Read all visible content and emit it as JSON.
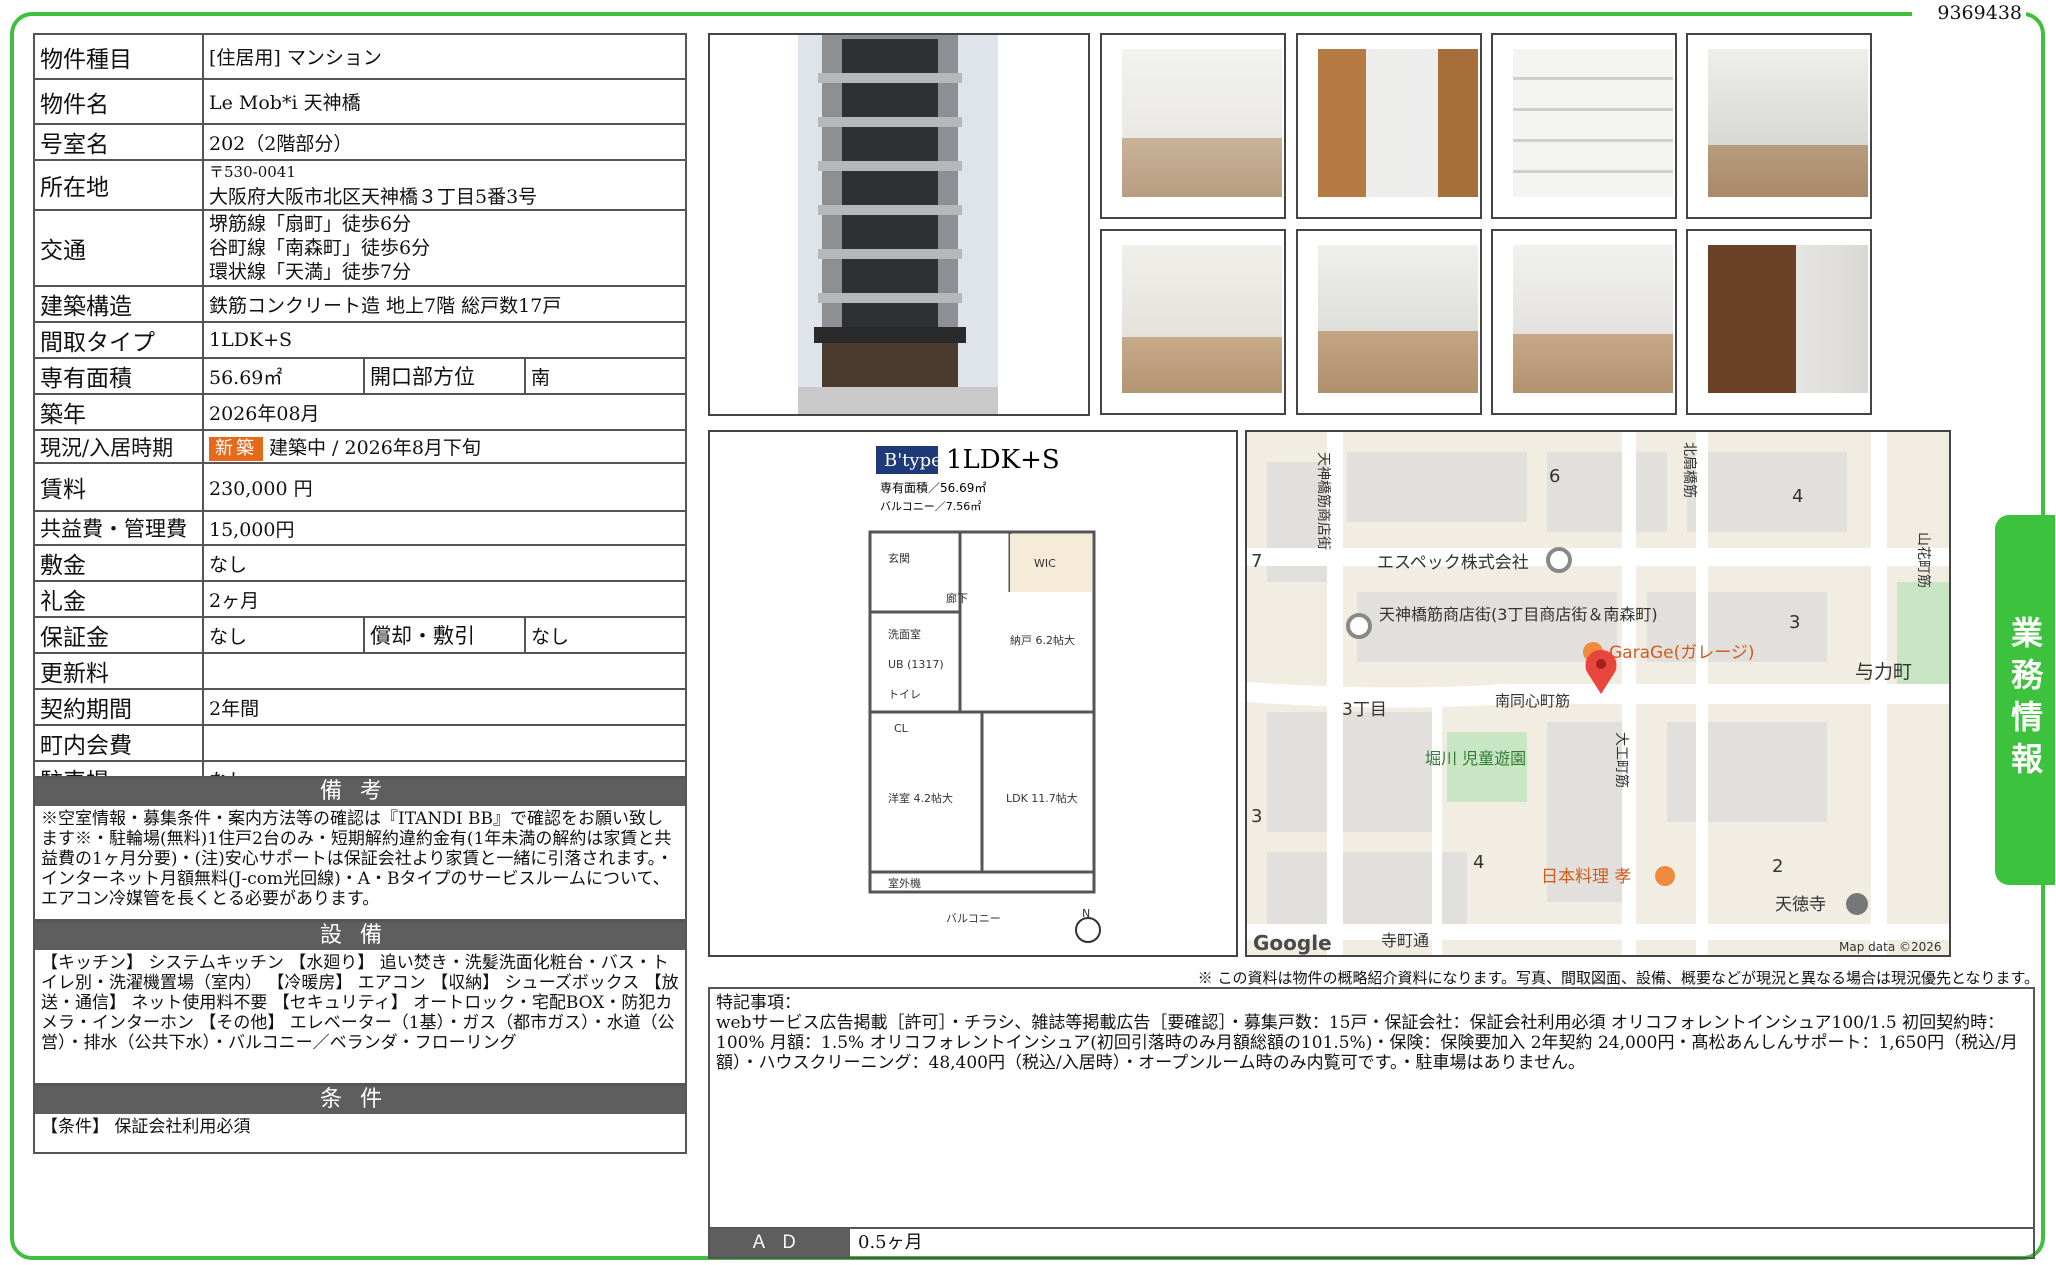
{
  "doc_number": "9369438",
  "side_tab": "業務情報",
  "property": {
    "type_label": "物件種目",
    "type_value": "[住居用] マンション",
    "name_label": "物件名",
    "name_value": "Le Mob*i 天神橋",
    "room_label": "号室名",
    "room_value": "202（2階部分）",
    "address_label": "所在地",
    "postal": "〒530-0041",
    "address": "大阪府大阪市北区天神橋３丁目5番3号",
    "transport_label": "交通",
    "transport": [
      "堺筋線「扇町」徒歩6分",
      "谷町線「南森町」徒歩6分",
      "環状線「天満」徒歩7分"
    ],
    "structure_label": "建築構造",
    "structure_value": "鉄筋コンクリート造 地上7階 総戸数17戸",
    "layout_label": "間取タイプ",
    "layout_value": "1LDK+S",
    "area_label": "専有面積",
    "area_value": "56.69㎡",
    "direction_label": "開口部方位",
    "direction_value": "南",
    "built_label": "築年",
    "built_value": "2026年08月",
    "status_label": "現況/入居時期",
    "status_badge": "新築",
    "status_value": "建築中 / 2026年8月下旬",
    "rent_label": "賃料",
    "rent_value": "230,000 円",
    "fee_label": "共益費・管理費",
    "fee_value": "15,000円",
    "deposit_label": "敷金",
    "deposit_value": "なし",
    "key_money_label": "礼金",
    "key_money_value": "2ヶ月",
    "guarantee_label": "保証金",
    "guarantee_value": "なし",
    "amort_label": "償却・敷引",
    "amort_value": "なし",
    "renewal_label": "更新料",
    "renewal_value": "",
    "contract_label": "契約期間",
    "contract_value": "2年間",
    "community_label": "町内会費",
    "community_value": "",
    "parking_label": "駐車場",
    "parking_value": "なし"
  },
  "notes": {
    "title": "備考",
    "text": "※空室情報・募集条件・案内方法等の確認は『ITANDI BB』で確認をお願い致します※・駐輪場(無料)1住戸2台のみ・短期解約違約金有(1年未満の解約は家賃と共益費の1ヶ月分要)・(注)安心サポートは保証会社より家賃と一緒に引落されます。・インターネット月額無料(J-com光回線)・A・Bタイプのサービスルームについて、エアコン冷媒管を長くとる必要があります。"
  },
  "equipment": {
    "title": "設備",
    "text": "【キッチン】 システムキッチン 【水廻り】 追い焚き・洗髪洗面化粧台・バス・トイレ別・洗濯機置場（室内） 【冷暖房】 エアコン 【収納】 シューズボックス 【放送・通信】 ネット使用料不要 【セキュリティ】 オートロック・宅配BOX・防犯カメラ・インターホン 【その他】 エレベーター（1基）・ガス（都市ガス）・水道（公営）・排水（公共下水）・バルコニー／ベランダ・フローリング"
  },
  "conditions": {
    "title": "条件",
    "text": "【条件】 保証会社利用必須"
  },
  "floorplan": {
    "type_mark": "B'type",
    "layout": "1LDK+S",
    "area": "専有面積／56.69㎡",
    "balcony": "バルコニー／7.56㎡",
    "rooms": [
      "WIC",
      "納戸 6.2帖大",
      "洋室 4.2帖大",
      "LDK 11.7帖大",
      "バルコニー",
      "UB (1317)",
      "洗面室",
      "玄関",
      "トイレ",
      "CL",
      "廊下",
      "室外機",
      "N"
    ]
  },
  "map": {
    "labels": [
      "6",
      "4",
      "7",
      "3",
      "3丁目",
      "3",
      "4",
      "2",
      "エスペック株式会社",
      "天神橋筋商店街(3丁目商店街＆南森町)",
      "GaraGe(ガレージ)",
      "与力町",
      "南同心町筋",
      "堀川 児童遊園",
      "日本料理 孝",
      "天徳寺",
      "寺町通",
      "天神橋筋商店街",
      "北扇橋筋",
      "大工町筋",
      "山花町筋"
    ],
    "logo": "Google",
    "attribution": "Map data ©2026"
  },
  "notice": "※ この資料は物件の概略紹介資料になります。写真、間取図面、設備、概要などが現況と異なる場合は現況優先となります。",
  "remarks": {
    "title": "特記事項：",
    "text": "webサービス広告掲載［許可］・チラシ、雑誌等掲載広告［要確認］・募集戸数：15戸・保証会社：保証会社利用必須 オリコフォレントインシュア100/1.5 初回契約時：100% 月額：1.5% オリコフォレントインシュア(初回引落時のみ月額総額の101.5%)・保険：保険要加入 2年契約 24,000円・髙松あんしんサポート：1,650円（税込/月額）・ハウスクリーニング：48,400円（税込/入居時）・オープンルーム時のみ内覧可です。・駐車場はありません。",
    "ad_label": "ＡＤ",
    "ad_value": "0.5ヶ月"
  },
  "colors": {
    "frame": "#3fbf3f",
    "header_bg": "#5e5e5e",
    "badge": "#e56a1a",
    "map_pin": "#e8453c"
  }
}
